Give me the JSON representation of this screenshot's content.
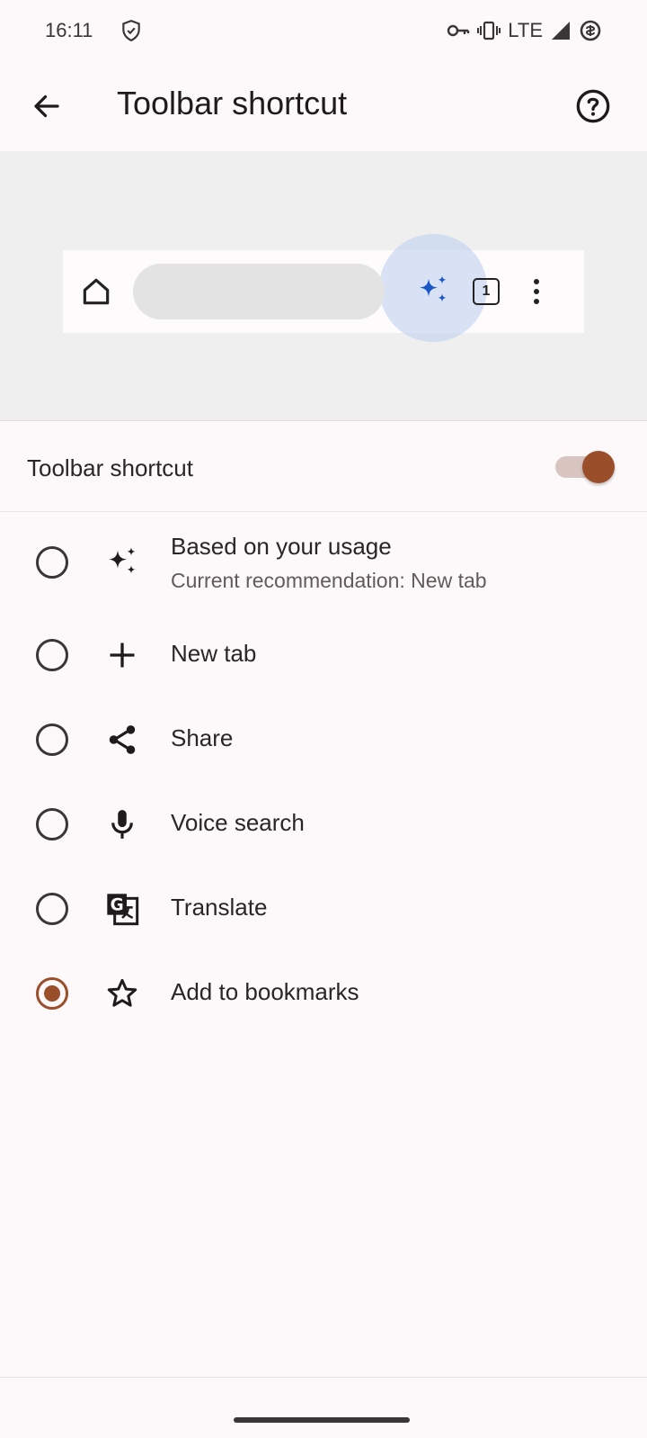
{
  "status_bar": {
    "time": "16:11",
    "network": "LTE",
    "icons": [
      "shield-check-icon",
      "vpn-key-icon",
      "vibrate-icon",
      "signal-icon",
      "data-saver-icon"
    ]
  },
  "app_bar": {
    "title": "Toolbar shortcut",
    "back_icon": "arrow-left-icon",
    "help_icon": "help-circle-icon"
  },
  "preview": {
    "tab_count": "1",
    "highlight_color": "#bacee e",
    "sparkle_color": "#1a56c7"
  },
  "toggle": {
    "label": "Toolbar shortcut",
    "enabled": true,
    "accent": "#9a4e2a"
  },
  "options": [
    {
      "label": "Based on your usage",
      "sublabel": "Current recommendation:  New tab",
      "icon": "sparkle-icon",
      "selected": false
    },
    {
      "label": "New tab",
      "icon": "plus-icon",
      "selected": false
    },
    {
      "label": "Share",
      "icon": "share-icon",
      "selected": false
    },
    {
      "label": "Voice search",
      "icon": "microphone-icon",
      "selected": false
    },
    {
      "label": "Translate",
      "icon": "translate-icon",
      "selected": false
    },
    {
      "label": "Add to bookmarks",
      "icon": "star-outline-icon",
      "selected": true
    }
  ]
}
